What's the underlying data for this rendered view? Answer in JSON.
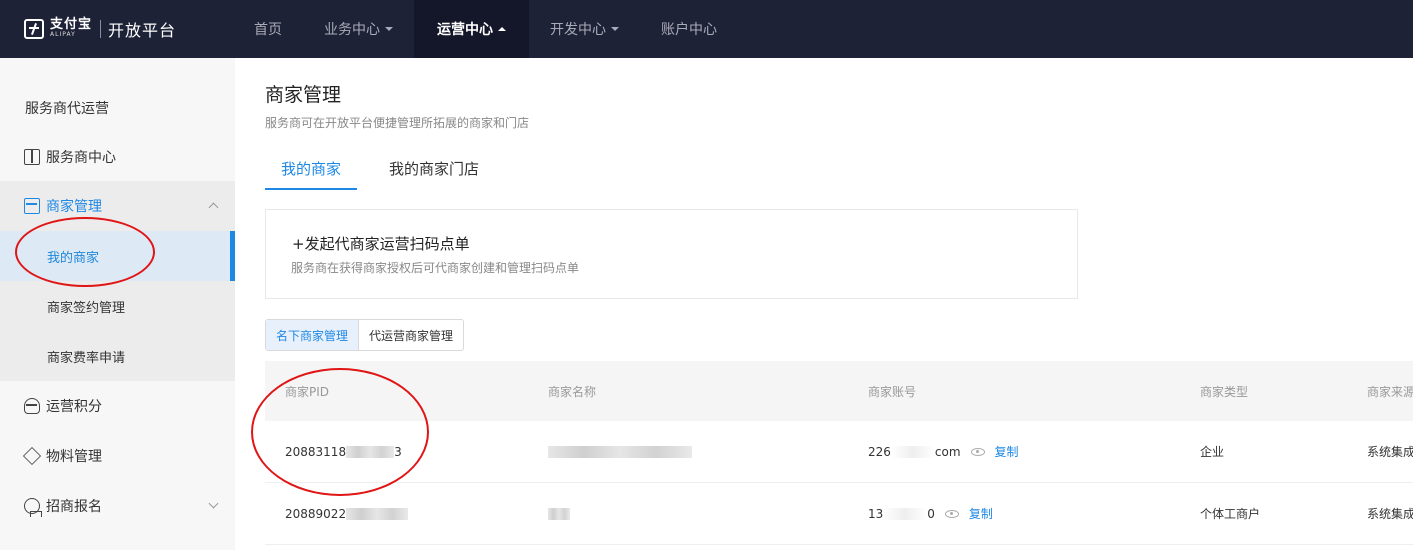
{
  "brand": {
    "logo_cn": "支付宝",
    "logo_en": "ALIPAY",
    "platform": "开放平台"
  },
  "nav": {
    "items": [
      {
        "label": "首页"
      },
      {
        "label": "业务中心"
      },
      {
        "label": "运营中心"
      },
      {
        "label": "开发中心"
      },
      {
        "label": "账户中心"
      }
    ]
  },
  "sidebar": {
    "items": [
      {
        "label": "服务商代运营"
      },
      {
        "label": "服务商中心"
      },
      {
        "label": "商家管理"
      },
      {
        "label": "运营积分"
      },
      {
        "label": "物料管理"
      },
      {
        "label": "招商报名"
      }
    ],
    "subitems": [
      {
        "label": "我的商家"
      },
      {
        "label": "商家签约管理"
      },
      {
        "label": "商家费率申请"
      }
    ]
  },
  "page": {
    "title": "商家管理",
    "subtitle": "服务商可在开放平台便捷管理所拓展的商家和门店",
    "tabs": [
      {
        "label": "我的商家"
      },
      {
        "label": "我的商家门店"
      }
    ]
  },
  "card": {
    "title": "+发起代商家运营扫码点单",
    "desc": "服务商在获得商家授权后可代商家创建和管理扫码点单"
  },
  "segment": {
    "buttons": [
      {
        "label": "名下商家管理"
      },
      {
        "label": "代运营商家管理"
      }
    ]
  },
  "table": {
    "columns": [
      "商家PID",
      "商家名称",
      "商家账号",
      "商家类型",
      "商家来源"
    ],
    "rows": [
      {
        "pid_prefix": "20883118",
        "pid_suffix": "3",
        "account_prefix": "226",
        "account_suffix": "com",
        "copy": "复制",
        "type": "企业",
        "source": "系统集成"
      },
      {
        "pid_prefix": "20889022",
        "pid_suffix": "",
        "account_prefix": "13",
        "account_suffix": "0",
        "copy": "复制",
        "type": "个体工商户",
        "source": "系统集成"
      }
    ]
  },
  "colors": {
    "topbar": "#1e2236",
    "accent": "#1e88e5",
    "annotation": "#e01515"
  }
}
